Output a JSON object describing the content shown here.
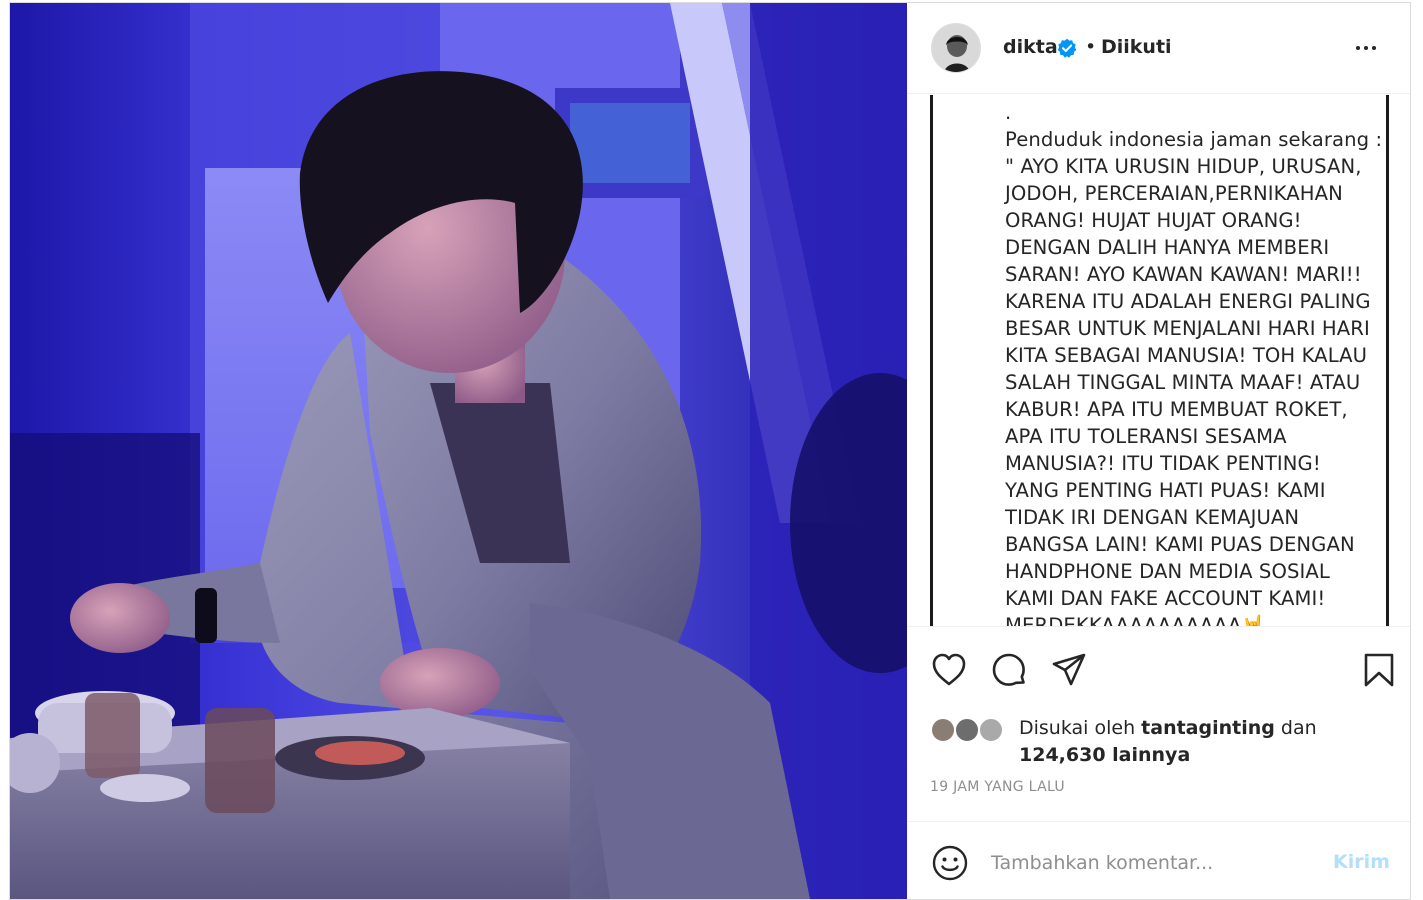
{
  "post": {
    "username": "dikta",
    "verified": true,
    "separator": "•",
    "follow_status": "Diikuti",
    "caption": ".\nPenduduk indonesia jaman sekarang :\n\" AYO KITA URUSIN HIDUP, URUSAN,\nJODOH, PERCERAIAN,PERNIKAHAN\nORANG! HUJAT HUJAT ORANG!\nDENGAN DALIH HANYA MEMBERI\nSARAN! AYO KAWAN KAWAN! MARI!!\nKARENA ITU ADALAH ENERGI PALING\nBESAR UNTUK MENJALANI HARI HARI\nKITA SEBAGAI MANUSIA! TOH KALAU\nSALAH TINGGAL MINTA MAAF! ATAU\nKABUR! APA ITU MEMBUAT ROKET,\nAPA ITU TOLERANSI SESAMA\nMANUSIA?! ITU TIDAK PENTING!\nYANG PENTING HATI PUAS! KAMI\nTIDAK IRI DENGAN KEMAJUAN\nBANGSA LAIN! KAMI PUAS DENGAN\nHANDPHONE DAN MEDIA SOSIAL\nKAMI DAN FAKE ACCOUNT KAMI!\nMERDEKKAAAAAAAAAA🤘"
  },
  "likes": {
    "prefix": "Disukai oleh",
    "liked_by": "tantaginting",
    "conjunction": "dan",
    "others": "124,630 lainnya"
  },
  "timestamp": "19 JAM YANG LALU",
  "comment": {
    "placeholder": "Tambahkan komentar...",
    "send_label": "Kirim"
  },
  "icons": {
    "like": "heart-icon",
    "comment": "comment-icon",
    "share": "paper-plane-icon",
    "save": "bookmark-icon",
    "more": "more-options-icon",
    "emoji": "emoji-icon",
    "verified": "verified-badge-icon"
  },
  "colors": {
    "verified_blue": "#0095f6",
    "send_disabled": "#b2dffc",
    "muted_text": "#8e8e8e"
  }
}
